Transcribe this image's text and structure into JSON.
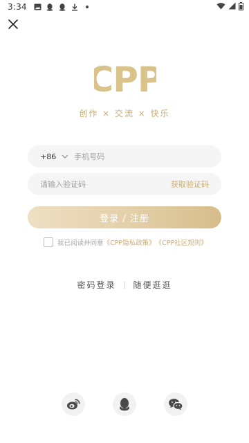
{
  "status_bar": {
    "time": "3:34",
    "left_icons": [
      "image-icon",
      "qq-notification-icon",
      "qq-notification-icon",
      "download-icon",
      "dot-icon"
    ],
    "right_icons": [
      "wifi-icon",
      "signal-icon",
      "battery-icon"
    ]
  },
  "close_icon": "close-icon",
  "logo": {
    "text": "CPP",
    "color": "#d9c38a"
  },
  "slogan": "创作 × 交流 × 快乐",
  "phone_field": {
    "country_code": "+86",
    "placeholder": "手机号码"
  },
  "code_field": {
    "placeholder": "请输入验证码",
    "get_code_label": "获取验证码"
  },
  "login_button": {
    "label": "登录 / 注册"
  },
  "agreement": {
    "prefix": "我已阅读并同意",
    "privacy_link": "《CPP隐私政策》",
    "rules_link": "《CPP社区规则》",
    "checked": false
  },
  "alt_options": {
    "password_login": "密码登录",
    "browse": "随便逛逛"
  },
  "social_logins": [
    "weibo-icon",
    "qq-icon",
    "wechat-icon"
  ],
  "colors": {
    "accent": "#c9ad77",
    "button_gradient_start": "#eedfc3",
    "button_gradient_end": "#d6bd8a",
    "field_bg": "#f5f5f5"
  }
}
